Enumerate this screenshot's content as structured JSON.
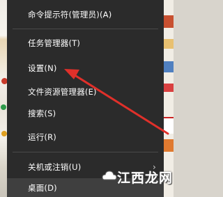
{
  "menu": {
    "items": [
      {
        "label": "命令提示符(管理员)(A)",
        "submenu": false
      },
      {
        "label": "任务管理器(T)",
        "submenu": false
      },
      {
        "label": "设置(N)",
        "submenu": false
      },
      {
        "label": "文件资源管理器(E)",
        "submenu": false
      },
      {
        "label": "搜索(S)",
        "submenu": false
      },
      {
        "label": "运行(R)",
        "submenu": false
      },
      {
        "label": "关机或注销(U)",
        "submenu": true
      },
      {
        "label": "桌面(D)",
        "submenu": false,
        "highlighted": true
      }
    ],
    "submenu_glyph": "›"
  },
  "watermark": {
    "text": "江西龙网"
  },
  "colors": {
    "menu_bg": "#2b2b2b",
    "menu_text": "#ffffff",
    "highlight_bg": "#3f3f3f",
    "separator": "#4a4a4a",
    "arrow": "#e0302a"
  },
  "icons": {
    "submenu_arrow": "chevron-right-icon",
    "annotation": "red-arrow-icon",
    "watermark_logo": "cloud-logo"
  }
}
